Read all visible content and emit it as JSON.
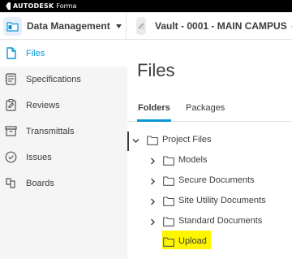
{
  "brand": {
    "company": "AUTODESK",
    "product": "Forma"
  },
  "header": {
    "module": {
      "label": "Data Management",
      "icon": "folder-module-icon"
    },
    "project": {
      "label": "Vault - 0001 - MAIN CAMPUS",
      "icon": "project-icon"
    }
  },
  "sidebar": {
    "items": [
      {
        "label": "Files",
        "icon": "document-icon",
        "active": true
      },
      {
        "label": "Specifications",
        "icon": "specifications-icon",
        "active": false
      },
      {
        "label": "Reviews",
        "icon": "reviews-icon",
        "active": false
      },
      {
        "label": "Transmittals",
        "icon": "transmittals-icon",
        "active": false
      },
      {
        "label": "Issues",
        "icon": "issues-icon",
        "active": false
      },
      {
        "label": "Boards",
        "icon": "boards-icon",
        "active": false
      }
    ]
  },
  "main": {
    "title": "Files",
    "tabs": [
      {
        "label": "Folders",
        "active": true
      },
      {
        "label": "Packages",
        "active": false
      }
    ],
    "tree": {
      "root": {
        "label": "Project Files",
        "expanded": true
      },
      "children": [
        {
          "label": "Models"
        },
        {
          "label": "Secure Documents"
        },
        {
          "label": "Site Utility Documents"
        },
        {
          "label": "Standard Documents"
        },
        {
          "label": "Upload",
          "highlighted": true
        }
      ]
    }
  },
  "colors": {
    "accent": "#0696d7",
    "highlight": "#fdf600",
    "sidebar_bg": "#f5f5f5",
    "text": "#3c3c3c"
  }
}
